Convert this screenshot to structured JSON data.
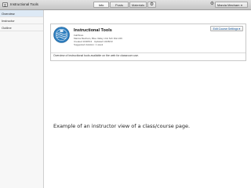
{
  "app": {
    "title": "Instructional Tools"
  },
  "tabs": [
    {
      "label": "Info",
      "active": true
    },
    {
      "label": "Posts",
      "active": false
    },
    {
      "label": "Materials",
      "active": false
    }
  ],
  "toolbar": {
    "settings_icon": "gear-icon"
  },
  "user": {
    "name": "Marcia Mecham",
    "icon": "gear-icon"
  },
  "sidebar": {
    "items": [
      {
        "label": "Overview",
        "active": true
      },
      {
        "label": "Instructor",
        "active": false
      },
      {
        "label": "Outline",
        "active": false
      }
    ]
  },
  "course": {
    "title": "Instructional Tools",
    "meta": [
      "Fall/Sisto",
      "Marcia Mecham, Blue Valley Unit Sch Dist 229",
      "Created 10/28/13 · Updated 10/28/13",
      "Suggested duration: 1 week"
    ],
    "edit_label": "Edit Course Settings ▾",
    "overview": "Overview of instructional tools available on the web for classroom use."
  },
  "caption": "Example of an instructor view of a class/course page.",
  "colors": {
    "accent": "#1c5fa5",
    "logo_blue": "#2f7fbf"
  }
}
